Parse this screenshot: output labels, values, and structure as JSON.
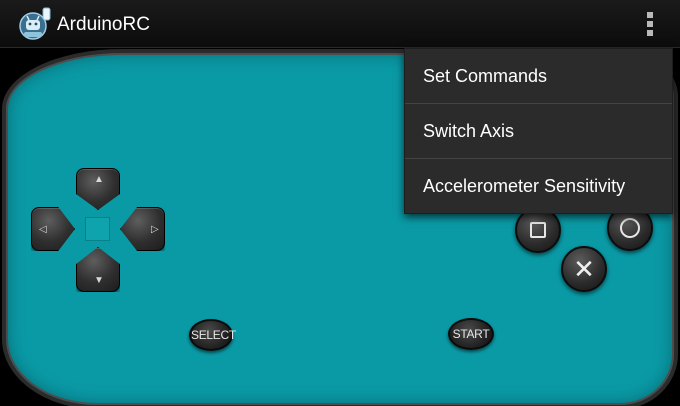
{
  "app": {
    "title": "ArduinoRC",
    "icon": "android-gamepad-app-icon"
  },
  "actionbar": {
    "overflow_icon": "overflow-menu-icon"
  },
  "menu": {
    "items": [
      {
        "label": "Set Commands"
      },
      {
        "label": "Switch Axis"
      },
      {
        "label": "Accelerometer Sensitivity"
      }
    ]
  },
  "dpad": {
    "up_glyph": "▲",
    "down_glyph": "▼",
    "left_glyph": "◁",
    "right_glyph": "▷"
  },
  "buttons": {
    "select_label": "SELECT",
    "start_label": "START",
    "cross_glyph": "✕",
    "square_icon": "square-icon",
    "circle_icon": "circle-icon",
    "cross_icon": "cross-icon"
  },
  "colors": {
    "pad_body": "#0a9aa6",
    "actionbar": "#131313",
    "menu_bg": "#2b2b2b"
  }
}
